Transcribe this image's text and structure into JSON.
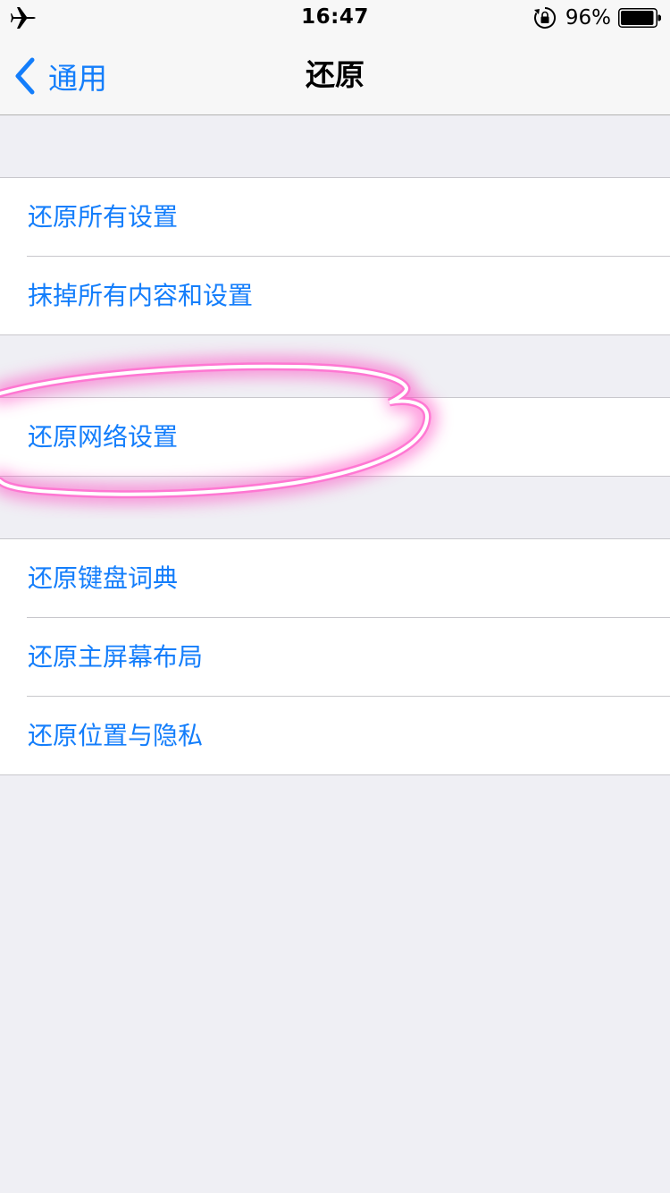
{
  "status_bar": {
    "time": "16:47",
    "battery_percent": "96%",
    "battery_level": 0.96,
    "icons": [
      "airplane-icon",
      "rotation-lock-icon",
      "battery-icon"
    ]
  },
  "nav": {
    "back_label": "通用",
    "title": "还原"
  },
  "groups": [
    {
      "items": [
        {
          "label": "还原所有设置"
        },
        {
          "label": "抹掉所有内容和设置"
        }
      ]
    },
    {
      "items": [
        {
          "label": "还原网络设置"
        }
      ]
    },
    {
      "items": [
        {
          "label": "还原键盘词典"
        },
        {
          "label": "还原主屏幕布局"
        },
        {
          "label": "还原位置与隐私"
        }
      ]
    }
  ],
  "colors": {
    "accent": "#147efb",
    "background": "#efeff4",
    "annotation": "#ff3fbf"
  }
}
